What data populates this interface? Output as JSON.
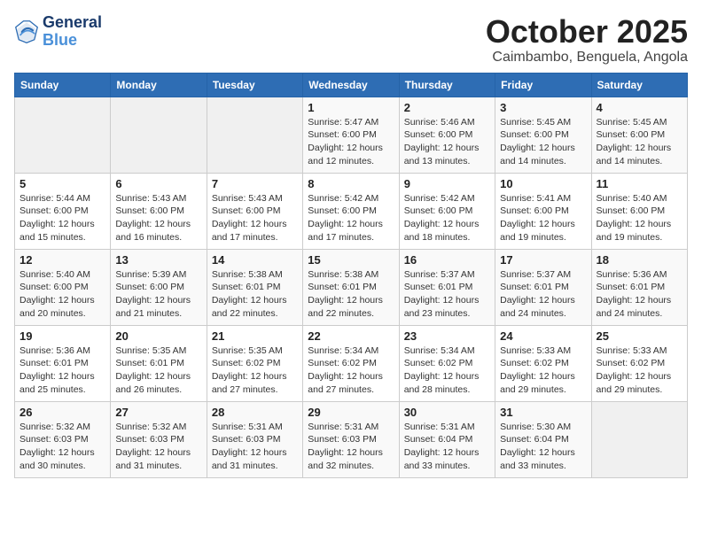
{
  "header": {
    "logo_line1": "General",
    "logo_line2": "Blue",
    "month": "October 2025",
    "location": "Caimbambo, Benguela, Angola"
  },
  "weekdays": [
    "Sunday",
    "Monday",
    "Tuesday",
    "Wednesday",
    "Thursday",
    "Friday",
    "Saturday"
  ],
  "weeks": [
    [
      {
        "day": "",
        "info": ""
      },
      {
        "day": "",
        "info": ""
      },
      {
        "day": "",
        "info": ""
      },
      {
        "day": "1",
        "info": "Sunrise: 5:47 AM\nSunset: 6:00 PM\nDaylight: 12 hours\nand 12 minutes."
      },
      {
        "day": "2",
        "info": "Sunrise: 5:46 AM\nSunset: 6:00 PM\nDaylight: 12 hours\nand 13 minutes."
      },
      {
        "day": "3",
        "info": "Sunrise: 5:45 AM\nSunset: 6:00 PM\nDaylight: 12 hours\nand 14 minutes."
      },
      {
        "day": "4",
        "info": "Sunrise: 5:45 AM\nSunset: 6:00 PM\nDaylight: 12 hours\nand 14 minutes."
      }
    ],
    [
      {
        "day": "5",
        "info": "Sunrise: 5:44 AM\nSunset: 6:00 PM\nDaylight: 12 hours\nand 15 minutes."
      },
      {
        "day": "6",
        "info": "Sunrise: 5:43 AM\nSunset: 6:00 PM\nDaylight: 12 hours\nand 16 minutes."
      },
      {
        "day": "7",
        "info": "Sunrise: 5:43 AM\nSunset: 6:00 PM\nDaylight: 12 hours\nand 17 minutes."
      },
      {
        "day": "8",
        "info": "Sunrise: 5:42 AM\nSunset: 6:00 PM\nDaylight: 12 hours\nand 17 minutes."
      },
      {
        "day": "9",
        "info": "Sunrise: 5:42 AM\nSunset: 6:00 PM\nDaylight: 12 hours\nand 18 minutes."
      },
      {
        "day": "10",
        "info": "Sunrise: 5:41 AM\nSunset: 6:00 PM\nDaylight: 12 hours\nand 19 minutes."
      },
      {
        "day": "11",
        "info": "Sunrise: 5:40 AM\nSunset: 6:00 PM\nDaylight: 12 hours\nand 19 minutes."
      }
    ],
    [
      {
        "day": "12",
        "info": "Sunrise: 5:40 AM\nSunset: 6:00 PM\nDaylight: 12 hours\nand 20 minutes."
      },
      {
        "day": "13",
        "info": "Sunrise: 5:39 AM\nSunset: 6:00 PM\nDaylight: 12 hours\nand 21 minutes."
      },
      {
        "day": "14",
        "info": "Sunrise: 5:38 AM\nSunset: 6:01 PM\nDaylight: 12 hours\nand 22 minutes."
      },
      {
        "day": "15",
        "info": "Sunrise: 5:38 AM\nSunset: 6:01 PM\nDaylight: 12 hours\nand 22 minutes."
      },
      {
        "day": "16",
        "info": "Sunrise: 5:37 AM\nSunset: 6:01 PM\nDaylight: 12 hours\nand 23 minutes."
      },
      {
        "day": "17",
        "info": "Sunrise: 5:37 AM\nSunset: 6:01 PM\nDaylight: 12 hours\nand 24 minutes."
      },
      {
        "day": "18",
        "info": "Sunrise: 5:36 AM\nSunset: 6:01 PM\nDaylight: 12 hours\nand 24 minutes."
      }
    ],
    [
      {
        "day": "19",
        "info": "Sunrise: 5:36 AM\nSunset: 6:01 PM\nDaylight: 12 hours\nand 25 minutes."
      },
      {
        "day": "20",
        "info": "Sunrise: 5:35 AM\nSunset: 6:01 PM\nDaylight: 12 hours\nand 26 minutes."
      },
      {
        "day": "21",
        "info": "Sunrise: 5:35 AM\nSunset: 6:02 PM\nDaylight: 12 hours\nand 27 minutes."
      },
      {
        "day": "22",
        "info": "Sunrise: 5:34 AM\nSunset: 6:02 PM\nDaylight: 12 hours\nand 27 minutes."
      },
      {
        "day": "23",
        "info": "Sunrise: 5:34 AM\nSunset: 6:02 PM\nDaylight: 12 hours\nand 28 minutes."
      },
      {
        "day": "24",
        "info": "Sunrise: 5:33 AM\nSunset: 6:02 PM\nDaylight: 12 hours\nand 29 minutes."
      },
      {
        "day": "25",
        "info": "Sunrise: 5:33 AM\nSunset: 6:02 PM\nDaylight: 12 hours\nand 29 minutes."
      }
    ],
    [
      {
        "day": "26",
        "info": "Sunrise: 5:32 AM\nSunset: 6:03 PM\nDaylight: 12 hours\nand 30 minutes."
      },
      {
        "day": "27",
        "info": "Sunrise: 5:32 AM\nSunset: 6:03 PM\nDaylight: 12 hours\nand 31 minutes."
      },
      {
        "day": "28",
        "info": "Sunrise: 5:31 AM\nSunset: 6:03 PM\nDaylight: 12 hours\nand 31 minutes."
      },
      {
        "day": "29",
        "info": "Sunrise: 5:31 AM\nSunset: 6:03 PM\nDaylight: 12 hours\nand 32 minutes."
      },
      {
        "day": "30",
        "info": "Sunrise: 5:31 AM\nSunset: 6:04 PM\nDaylight: 12 hours\nand 33 minutes."
      },
      {
        "day": "31",
        "info": "Sunrise: 5:30 AM\nSunset: 6:04 PM\nDaylight: 12 hours\nand 33 minutes."
      },
      {
        "day": "",
        "info": ""
      }
    ]
  ]
}
